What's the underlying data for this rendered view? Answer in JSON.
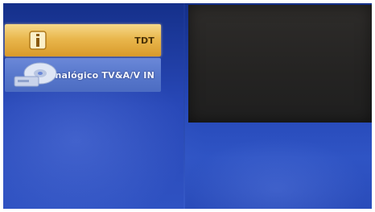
{
  "menu": {
    "items": [
      {
        "label": "TDT",
        "icon": "info-icon",
        "selected": true
      },
      {
        "label": "Analógico TV&A/V IN",
        "icon": "disc-icon",
        "selected": false
      }
    ]
  },
  "colors": {
    "background": "#2446b6",
    "selected_item": "#e9b74d",
    "item": "#5878cc",
    "preview": "#242322"
  }
}
